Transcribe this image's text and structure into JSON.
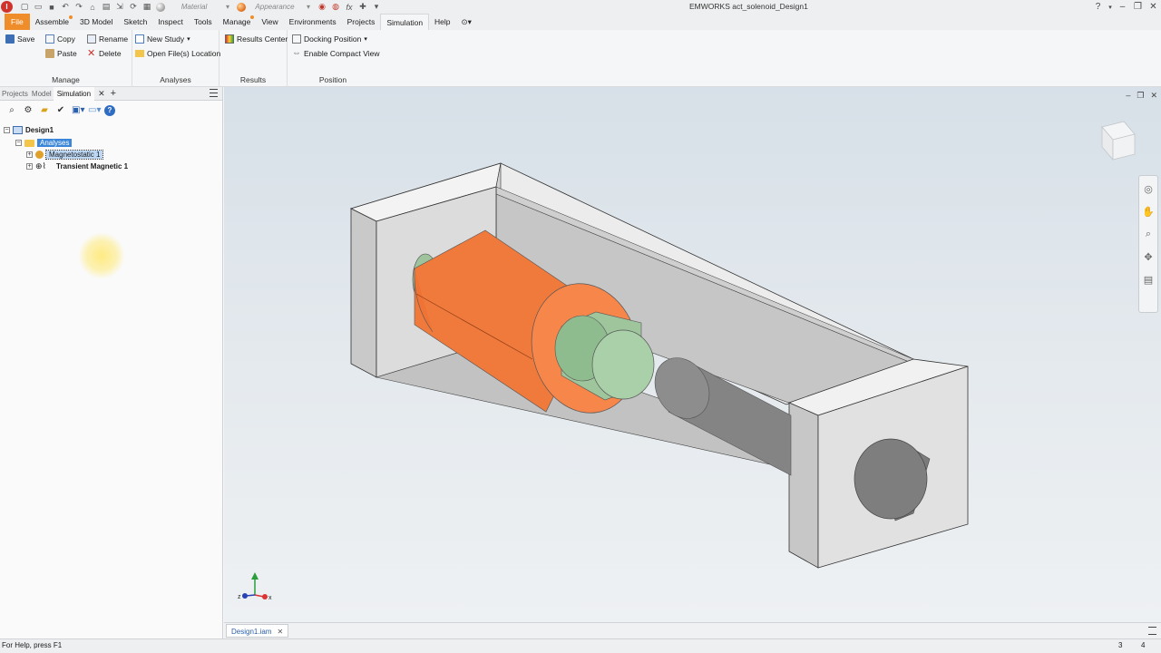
{
  "titlebar": {
    "title": "EMWORKS   act_solenoid_Design1",
    "material_placeholder": "Material",
    "appearance_placeholder": "Appearance"
  },
  "menu": {
    "tabs": [
      "File",
      "Assemble",
      "3D Model",
      "Sketch",
      "Inspect",
      "Tools",
      "Manage",
      "View",
      "Environments",
      "Projects",
      "Simulation",
      "Help"
    ],
    "active": "Simulation"
  },
  "ribbon": {
    "manage": {
      "save": "Save",
      "copy": "Copy",
      "rename": "Rename",
      "paste": "Paste",
      "delete": "Delete",
      "label": "Manage"
    },
    "analyses": {
      "new_study": "New Study",
      "open_location": "Open File(s) Location",
      "label": "Analyses"
    },
    "results": {
      "results_center": "Results Center",
      "label": "Results"
    },
    "position": {
      "docking": "Docking Position",
      "compact": "Enable Compact View",
      "label": "Position"
    }
  },
  "browser": {
    "tabs": [
      "Projects",
      "Model",
      "Simulation"
    ],
    "active_tab": "Simulation",
    "tree": {
      "root": "Design1",
      "folder": "Analyses",
      "study1": "Magnetostatic 1",
      "study2": "Transient Magnetic 1"
    }
  },
  "document_tab": "Design1.iam",
  "status": {
    "help": "For Help, press F1",
    "n1": "3",
    "n2": "4"
  },
  "colors": {
    "file_tab": "#f08d2b",
    "coil": "#f07a3c",
    "plunger": "#a9d0a8",
    "frame": "#e2e2e2",
    "gray_core": "#8c8c8c"
  }
}
